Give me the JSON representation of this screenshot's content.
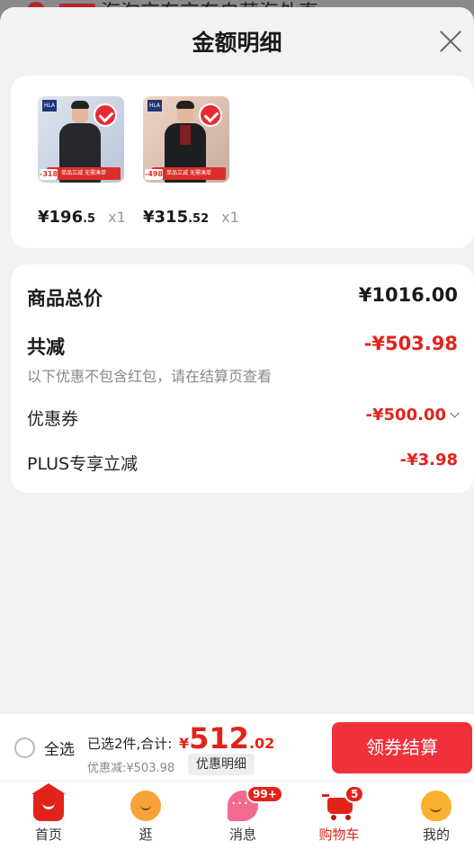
{
  "background": {
    "partial_text": "海淘京东京东自营海外直"
  },
  "sheet": {
    "title": "金额明细"
  },
  "products": [
    {
      "brand": "HLA",
      "tag": "-318",
      "promo": "单品立减 无需凑单",
      "price_int": "¥196",
      "price_dec": ".5",
      "qty": "x1"
    },
    {
      "brand": "HLA",
      "tag": "-498",
      "promo": "单品立减 无需凑单",
      "price_int": "¥315",
      "price_dec": ".52",
      "qty": "x1"
    }
  ],
  "summary": {
    "total_label": "商品总价",
    "total_value": "¥1016.00",
    "discount_label": "共减",
    "discount_value": "-¥503.98",
    "discount_note": "以下优惠不包含红包，请在结算页查看",
    "coupon_label": "优惠券",
    "coupon_value": "-¥500.00",
    "plus_label": "PLUS专享立减",
    "plus_value": "-¥3.98"
  },
  "bottom_bar": {
    "select_all": "全选",
    "selected_text": "已选2件,合计:",
    "total_yen": "¥",
    "total_int": "512",
    "total_dec": ".02",
    "discount_text": "优惠减:¥503.98",
    "detail_button": "优惠明细",
    "checkout_button": "领券结算"
  },
  "tabbar": {
    "items": [
      {
        "label": "首页",
        "icon": "home-icon"
      },
      {
        "label": "逛",
        "icon": "browse-icon"
      },
      {
        "label": "消息",
        "icon": "message-icon",
        "badge": "99+"
      },
      {
        "label": "购物车",
        "icon": "cart-icon",
        "badge": "5",
        "active": true
      },
      {
        "label": "我的",
        "icon": "profile-icon"
      }
    ]
  },
  "colors": {
    "accent": "#e2231a",
    "checkout": "#f0303a"
  }
}
